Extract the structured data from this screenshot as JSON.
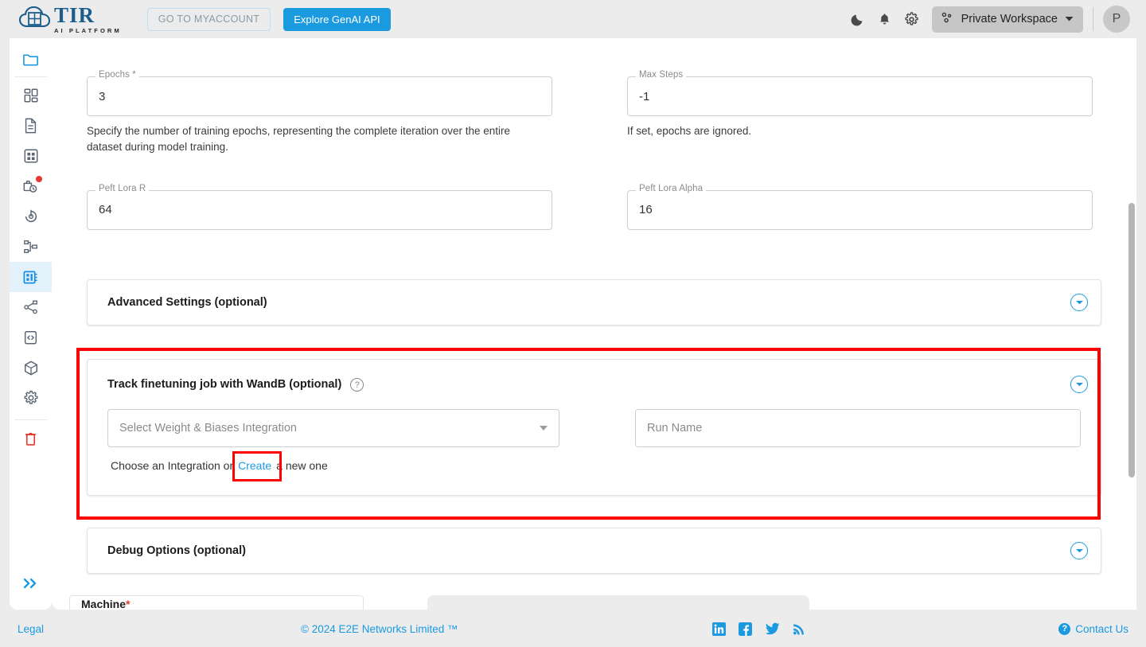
{
  "header": {
    "logo_title": "TIR",
    "logo_subtitle": "AI PLATFORM",
    "myaccount_label": "GO TO MYACCOUNT",
    "genai_label": "Explore GenAI API",
    "workspace_label": "Private Workspace",
    "avatar_initial": "P",
    "icons": {
      "dark_mode": "moon-icon",
      "notifications": "bell-icon",
      "settings": "gear-icon",
      "workspace": "workspace-nodes-icon",
      "workspace_caret": "chevron-down-icon"
    },
    "accent_color": "#1b9ae0"
  },
  "sidebar": {
    "items": [
      {
        "name": "folder",
        "label": "Projects"
      },
      {
        "name": "dashboard",
        "label": "Dashboard"
      },
      {
        "name": "document",
        "label": "Datasets"
      },
      {
        "name": "grid",
        "label": "Notebooks"
      },
      {
        "name": "jobs-clock",
        "label": "Jobs",
        "badge": true
      },
      {
        "name": "target",
        "label": "Model Endpoints"
      },
      {
        "name": "pipeline",
        "label": "Pipelines"
      },
      {
        "name": "chip",
        "label": "Finetuning",
        "selected": true
      },
      {
        "name": "share",
        "label": "Integrations"
      },
      {
        "name": "code-clipboard",
        "label": "API Tokens"
      },
      {
        "name": "cube",
        "label": "Models"
      },
      {
        "name": "gear",
        "label": "Settings"
      }
    ],
    "trash_label": "Trash",
    "expand_label": "Expand sidebar"
  },
  "form": {
    "fields": [
      {
        "label": "Epochs",
        "required": true,
        "value": "3",
        "help": "Specify the number of training epochs, representing the complete iteration over the entire dataset during model training."
      },
      {
        "label": "Max Steps",
        "required": false,
        "value": "-1",
        "help": "If set, epochs are ignored."
      },
      {
        "label": "Peft Lora R",
        "required": false,
        "value": "64",
        "help": ""
      },
      {
        "label": "Peft Lora Alpha",
        "required": false,
        "value": "16",
        "help": ""
      }
    ]
  },
  "advanced_settings": {
    "title": "Advanced Settings (optional)",
    "expand_icon": "chevron-down-circle-icon"
  },
  "wandb": {
    "title": "Track finetuning job with WandB (optional)",
    "help_icon": "question-mark-circle-icon",
    "expand_icon": "chevron-down-circle-icon",
    "select_placeholder": "Select Weight & Biases Integration",
    "select_caret": "caret-down-icon",
    "run_name_placeholder": "Run Name",
    "hint_prefix": "Choose an Integration or ",
    "hint_link": "Create",
    "hint_suffix": " a new one",
    "highlight_color": "#ff0000"
  },
  "debug_options": {
    "title": "Debug Options (optional)",
    "expand_icon": "chevron-down-circle-icon"
  },
  "clipped_bottom": {
    "label": "Machine",
    "required_star": "*"
  },
  "footer": {
    "legal": "Legal",
    "copyright": "© 2024 E2E Networks Limited ™",
    "contact": "Contact Us",
    "social": [
      {
        "name": "linkedin-icon",
        "label": "LinkedIn"
      },
      {
        "name": "facebook-icon",
        "label": "Facebook"
      },
      {
        "name": "twitter-icon",
        "label": "Twitter"
      },
      {
        "name": "rss-icon",
        "label": "RSS"
      }
    ]
  }
}
